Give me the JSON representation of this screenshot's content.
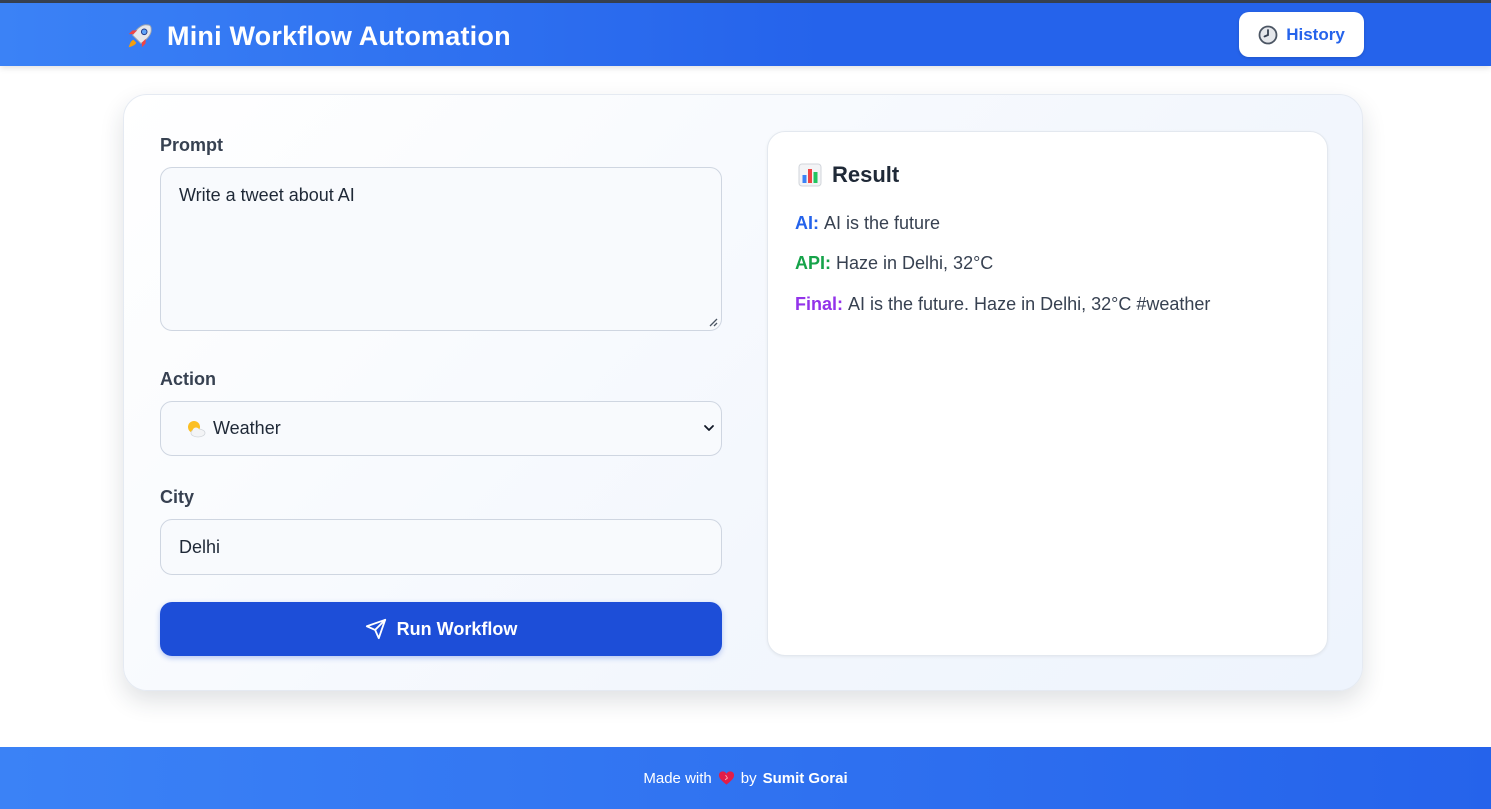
{
  "header": {
    "title": "Mini Workflow Automation",
    "logo_icon": "rocket-icon",
    "history_label": "History",
    "history_icon": "clock-icon",
    "accent": "#2563eb"
  },
  "form": {
    "prompt_label": "Prompt",
    "prompt_value": "Write a tweet about AI",
    "action_label": "Action",
    "action_selected": "Weather",
    "action_icon": "sun-behind-cloud-icon",
    "city_label": "City",
    "city_value": "Delhi",
    "run_label": "Run Workflow",
    "run_icon": "send-icon",
    "run_color": "#1d4ed8"
  },
  "result": {
    "title": "Result",
    "title_icon": "bar-chart-icon",
    "lines": [
      {
        "tag": "AI:",
        "text": "AI is the future",
        "color": "#2563eb"
      },
      {
        "tag": "API:",
        "text": "Haze in Delhi, 32°C",
        "color": "#16a34a"
      },
      {
        "tag": "Final:",
        "text": "AI is the future. Haze in Delhi, 32°C #weather",
        "color": "#9333ea"
      }
    ]
  },
  "footer": {
    "made_with": "Made with",
    "heart_icon": "heart-icon",
    "by": "by",
    "author": "Sumit Gorai"
  }
}
